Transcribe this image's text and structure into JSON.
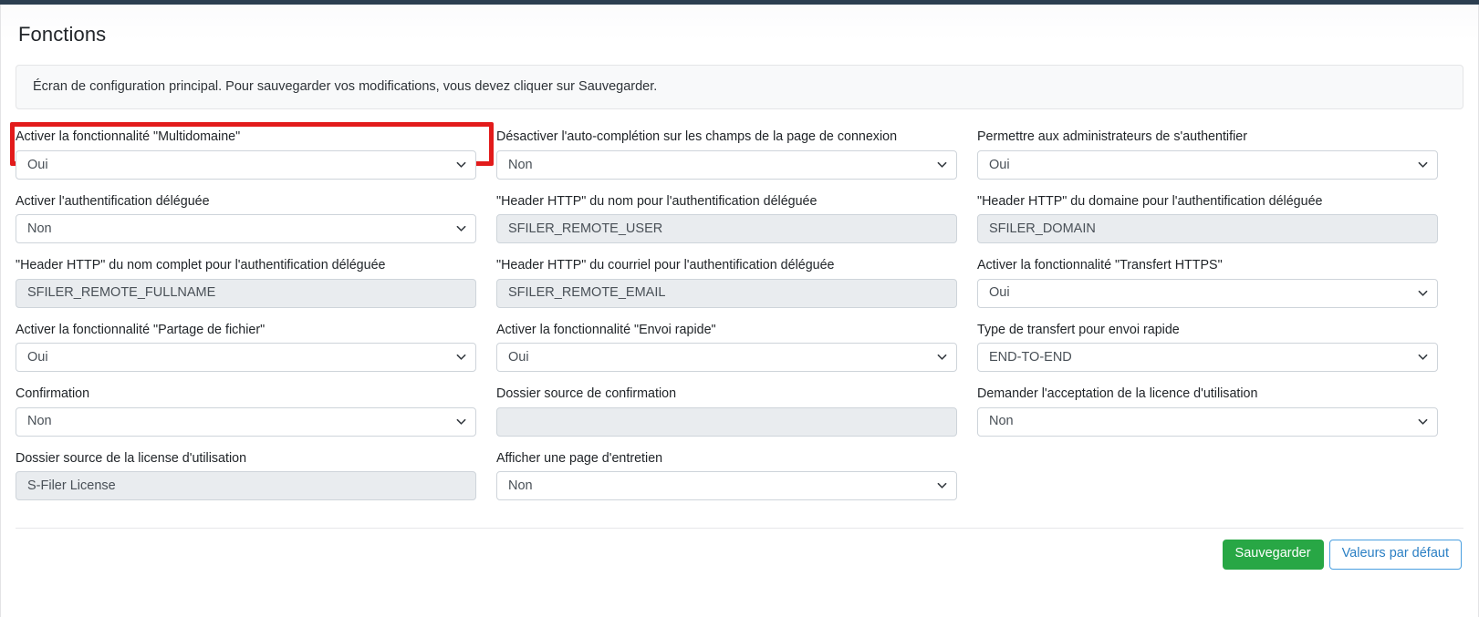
{
  "theme": {
    "topbar_color": "#2c3e50",
    "highlight_color": "#e21b1b",
    "save_button_color": "#28a745",
    "outline_button_color": "#2a7fc4"
  },
  "header": {
    "title": "Fonctions"
  },
  "alert": {
    "text": "Écran de configuration principal. Pour sauvegarder vos modifications, vous devez cliquer sur Sauvegarder."
  },
  "fields": [
    {
      "name": "activer-multidomaine",
      "label": "Activer la fonctionnalité \"Multidomaine\"",
      "type": "select",
      "value": "Oui",
      "disabled": false,
      "highlighted": true
    },
    {
      "name": "desactiver-auto-completion",
      "label": "Désactiver l'auto-complétion sur les champs de la page de connexion",
      "type": "select",
      "value": "Non",
      "disabled": false,
      "highlighted": false
    },
    {
      "name": "permettre-admins-authentifier",
      "label": "Permettre aux administrateurs de s'authentifier",
      "type": "select",
      "value": "Oui",
      "disabled": false,
      "highlighted": false
    },
    {
      "name": "activer-authentification-deleguee",
      "label": "Activer l'authentification déléguée",
      "type": "select",
      "value": "Non",
      "disabled": false,
      "highlighted": false
    },
    {
      "name": "header-http-nom",
      "label": "\"Header HTTP\" du nom pour l'authentification déléguée",
      "type": "text",
      "value": "SFILER_REMOTE_USER",
      "disabled": true,
      "highlighted": false
    },
    {
      "name": "header-http-domaine",
      "label": "\"Header HTTP\" du domaine pour l'authentification déléguée",
      "type": "text",
      "value": "SFILER_DOMAIN",
      "disabled": true,
      "highlighted": false
    },
    {
      "name": "header-http-nom-complet",
      "label": "\"Header HTTP\" du nom complet pour l'authentification déléguée",
      "type": "text",
      "value": "SFILER_REMOTE_FULLNAME",
      "disabled": true,
      "highlighted": false
    },
    {
      "name": "header-http-courriel",
      "label": "\"Header HTTP\" du courriel pour l'authentification déléguée",
      "type": "text",
      "value": "SFILER_REMOTE_EMAIL",
      "disabled": true,
      "highlighted": false
    },
    {
      "name": "activer-transfert-https",
      "label": "Activer la fonctionnalité \"Transfert HTTPS\"",
      "type": "select",
      "value": "Oui",
      "disabled": false,
      "highlighted": false
    },
    {
      "name": "activer-partage-de-fichier",
      "label": "Activer la fonctionnalité \"Partage de fichier\"",
      "type": "select",
      "value": "Oui",
      "disabled": false,
      "highlighted": false
    },
    {
      "name": "activer-envoi-rapide",
      "label": "Activer la fonctionnalité \"Envoi rapide\"",
      "type": "select",
      "value": "Oui",
      "disabled": false,
      "highlighted": false
    },
    {
      "name": "type-transfert-envoi-rapide",
      "label": "Type de transfert pour envoi rapide",
      "type": "select",
      "value": "END-TO-END",
      "disabled": false,
      "highlighted": false
    },
    {
      "name": "confirmation",
      "label": "Confirmation",
      "type": "select",
      "value": "Non",
      "disabled": false,
      "highlighted": false
    },
    {
      "name": "dossier-source-confirmation",
      "label": "Dossier source de confirmation",
      "type": "text",
      "value": "",
      "disabled": true,
      "highlighted": false
    },
    {
      "name": "demander-acceptation-licence",
      "label": "Demander l'acceptation de la licence d'utilisation",
      "type": "select",
      "value": "Non",
      "disabled": false,
      "highlighted": false
    },
    {
      "name": "dossier-source-licence",
      "label": "Dossier source de la license d'utilisation",
      "type": "text",
      "value": "S-Filer License",
      "disabled": true,
      "highlighted": false
    },
    {
      "name": "afficher-page-entretien",
      "label": "Afficher une page d'entretien",
      "type": "select",
      "value": "Non",
      "disabled": false,
      "highlighted": false
    }
  ],
  "footer": {
    "save_label": "Sauvegarder",
    "defaults_label": "Valeurs par défaut"
  }
}
